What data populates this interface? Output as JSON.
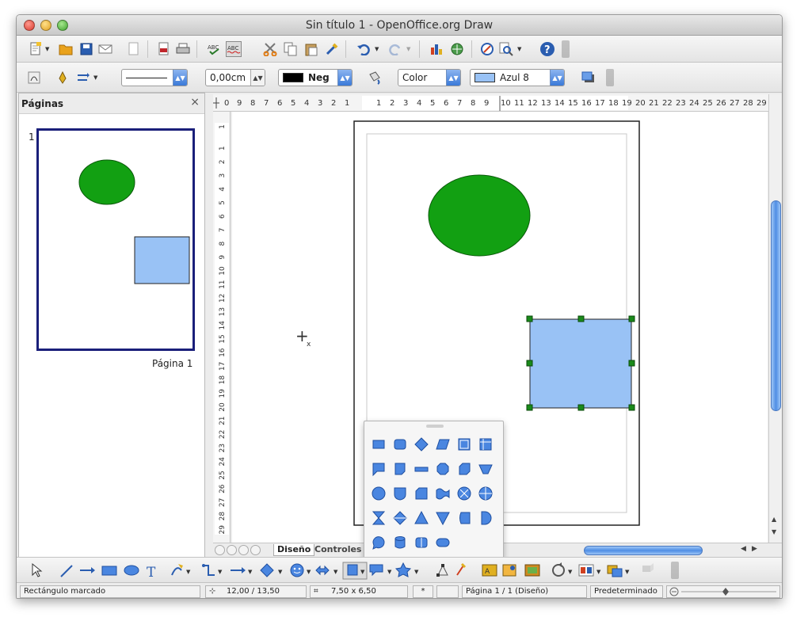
{
  "window": {
    "title": "Sin título 1 - OpenOffice.org Draw"
  },
  "toolbar_standard": {
    "icons": [
      "new-document-icon",
      "open-icon",
      "save-icon",
      "email-icon",
      "edit-file-icon",
      "export-pdf-icon",
      "print-icon",
      "spellcheck-icon",
      "autospellcheck-icon",
      "cut-icon",
      "copy-icon",
      "paste-icon",
      "clone-format-icon",
      "undo-icon",
      "redo-icon",
      "chart-icon",
      "navigator-icon",
      "zoom-icon",
      "help-icon"
    ]
  },
  "toolbar_line_fill": {
    "line_width": "0,00cm",
    "line_color": {
      "label": "Neg",
      "hex": "#000000"
    },
    "area_style": "Color",
    "area_color": {
      "label": "Azul 8",
      "hex": "#99c2f5"
    }
  },
  "pages_panel": {
    "title": "Páginas",
    "close_glyph": "×",
    "page_number": "1",
    "page_label": "Página 1"
  },
  "ruler_h": [
    "0",
    "9",
    "8",
    "7",
    "6",
    "5",
    "4",
    "3",
    "2",
    "1",
    "1",
    "2",
    "3",
    "4",
    "5",
    "6",
    "7",
    "8",
    "9",
    "10",
    "11",
    "12",
    "13",
    "14",
    "15",
    "16",
    "17",
    "18",
    "19",
    "20",
    "21",
    "22",
    "23",
    "24",
    "25",
    "26",
    "27",
    "28",
    "29"
  ],
  "ruler_v": [
    "1",
    "1",
    "2",
    "3",
    "4",
    "5",
    "6",
    "7",
    "8",
    "9",
    "10",
    "11",
    "12",
    "13",
    "14",
    "15",
    "16",
    "17",
    "18",
    "19",
    "20",
    "21",
    "22",
    "23",
    "24",
    "25",
    "26",
    "27",
    "28",
    "29"
  ],
  "canvas": {
    "ellipse_color": "#12a012",
    "rect_color": "#99c2f5",
    "cursor_text": "+",
    "cursor_sub": "x"
  },
  "tabs": {
    "design": "Diseño",
    "controls": "Controles"
  },
  "shape_popup": {
    "icons": [
      "rectangle-icon",
      "rounded-rectangle-icon",
      "diamond-icon",
      "parallelogram-icon",
      "square-icon",
      "table-icon",
      "callout-icon",
      "folded-corner-icon",
      "minus-icon",
      "octagon-icon",
      "cube-icon",
      "trapezoid-icon",
      "circle-icon",
      "shield-icon",
      "snipped-rect-icon",
      "wave-icon",
      "circle-x-icon",
      "circle-plus-icon",
      "hourglass-icon",
      "diamond-split-icon",
      "triangle-up-icon",
      "triangle-down-icon",
      "can-icon",
      "half-moon-icon",
      "speech-bubble-icon",
      "cylinder-icon",
      "scroll-icon",
      "rounded-pill-icon"
    ]
  },
  "toolbar_drawing": {
    "icons": [
      "select-icon",
      "line-icon",
      "arrow-icon",
      "rectangle-icon",
      "ellipse-icon",
      "text-icon",
      "curve-icon",
      "connector-icon",
      "lines-arrows-icon",
      "basic-shapes-icon",
      "symbol-shapes-icon",
      "block-arrows-icon",
      "flowchart-icon",
      "callouts-icon",
      "stars-icon",
      "points-icon",
      "glue-points-icon",
      "fontwork-icon",
      "from-file-icon",
      "gallery-icon",
      "rotate-icon",
      "alignment-icon",
      "arrange-icon",
      "extrusion-icon"
    ]
  },
  "status_bar": {
    "selection": "Rectángulo marcado",
    "position": "12,00 / 13,50",
    "size": "7,50 x 6,50",
    "star": "*",
    "page": "Página 1 / 1 (Diseño)",
    "style": "Predeterminado"
  }
}
